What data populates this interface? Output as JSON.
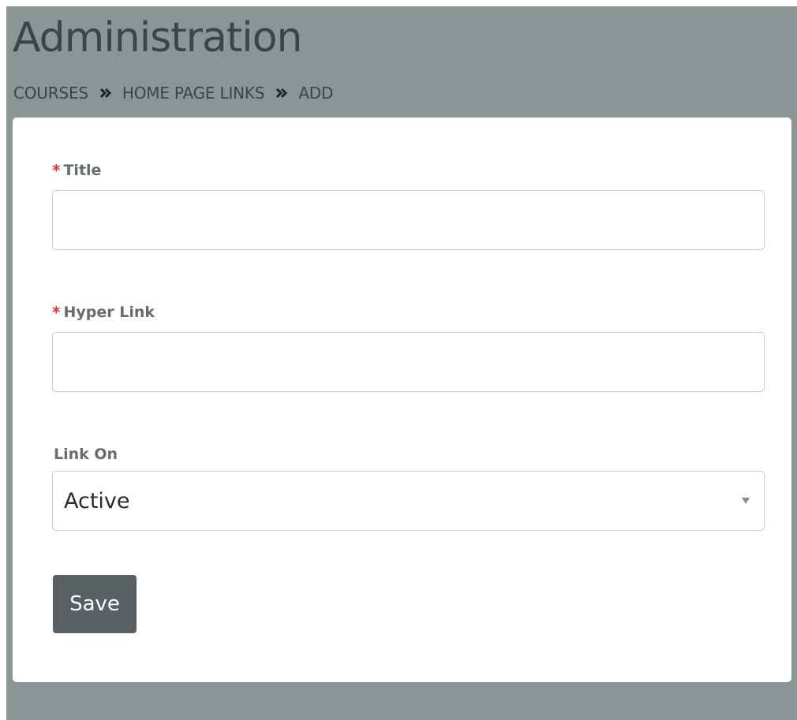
{
  "header": {
    "title": "Administration",
    "breadcrumb": [
      "COURSES",
      "HOME PAGE LINKS",
      "ADD"
    ],
    "separator_icon": "double-chevron-right-icon"
  },
  "form": {
    "title_field": {
      "label": "Title",
      "required_marker": "*",
      "value": ""
    },
    "hyperlink_field": {
      "label": "Hyper Link",
      "required_marker": "*",
      "value": ""
    },
    "link_on_field": {
      "label": "Link On",
      "selected": "Active"
    },
    "save_label": "Save"
  },
  "colors": {
    "page_background": "#8a9596",
    "card_background": "#ffffff",
    "required_star": "#e03030",
    "button_background": "#586061"
  }
}
